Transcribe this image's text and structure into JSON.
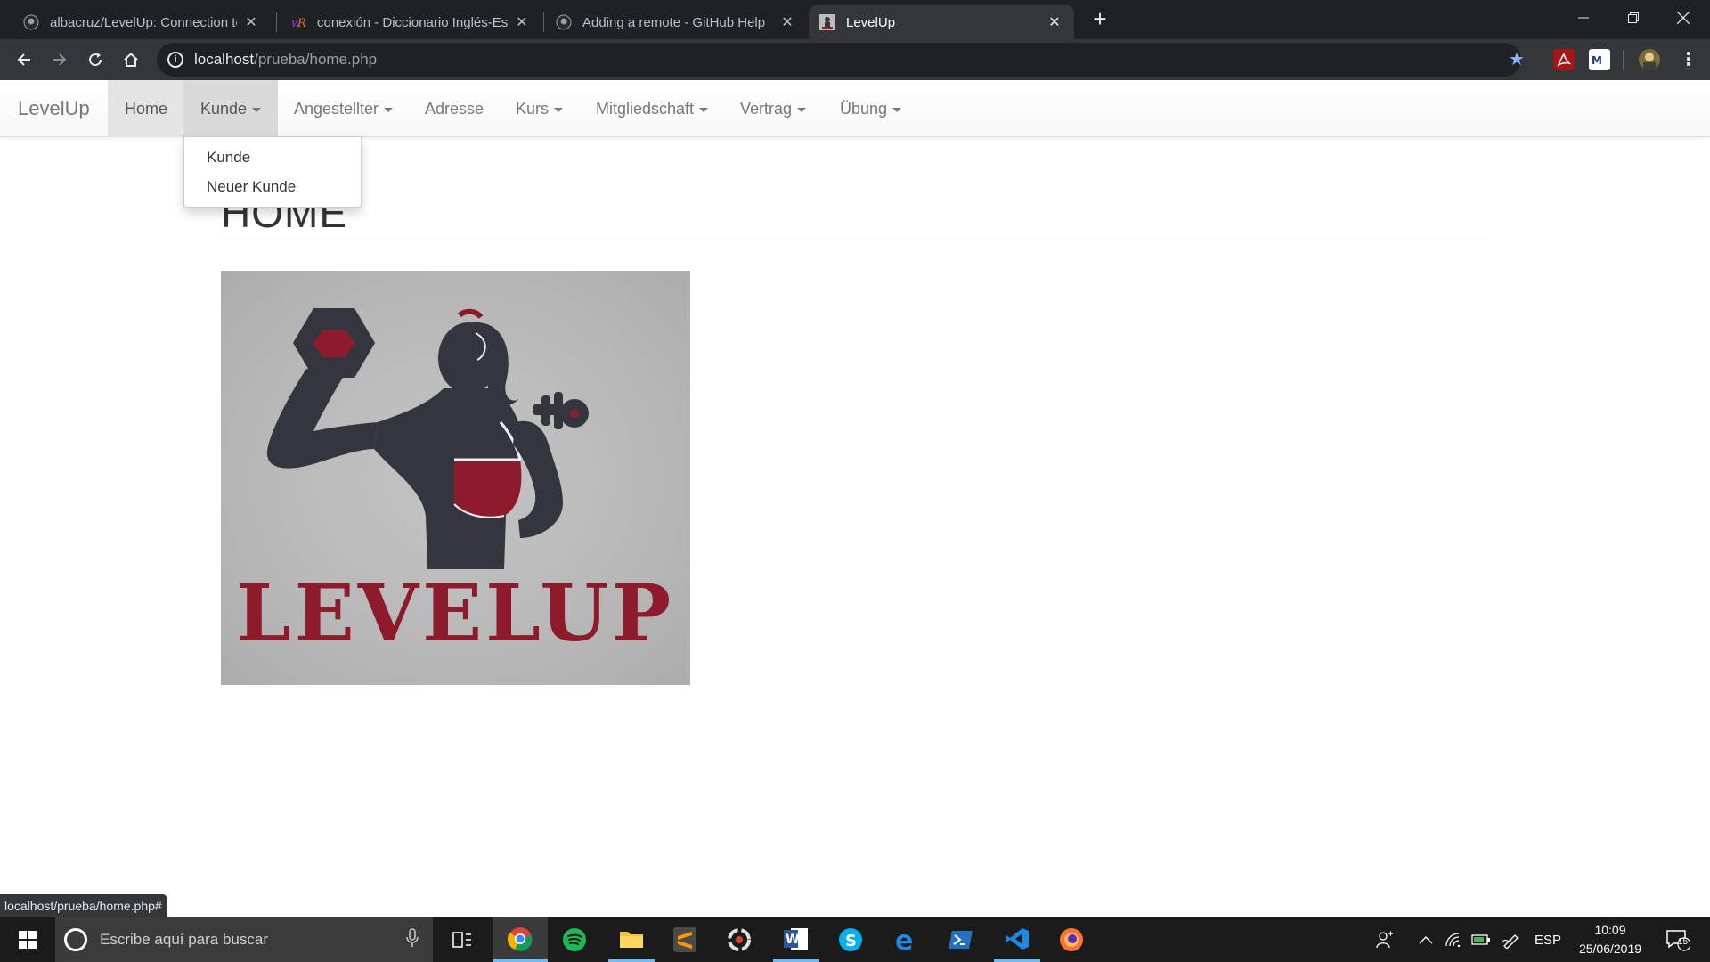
{
  "browser": {
    "tabs": [
      {
        "title": "albacruz/LevelUp: Connection to",
        "icon": "github-icon"
      },
      {
        "title": "conexión - Diccionario Inglés-Esp",
        "icon": "wordreference-icon"
      },
      {
        "title": "Adding a remote - GitHub Help",
        "icon": "github-icon"
      },
      {
        "title": "LevelUp",
        "icon": "levelup-favicon"
      }
    ],
    "new_tab": "+",
    "url_host": "localhost",
    "url_path": "/prueba/home.php",
    "status_url": "localhost/prueba/home.php#"
  },
  "navbar": {
    "brand": "LevelUp",
    "items": [
      {
        "label": "Home",
        "dropdown": false
      },
      {
        "label": "Kunde",
        "dropdown": true
      },
      {
        "label": "Angestellter",
        "dropdown": true
      },
      {
        "label": "Adresse",
        "dropdown": false
      },
      {
        "label": "Kurs",
        "dropdown": true
      },
      {
        "label": "Mitgliedschaft",
        "dropdown": true
      },
      {
        "label": "Vertrag",
        "dropdown": true
      },
      {
        "label": "Übung",
        "dropdown": true
      }
    ],
    "open_dropdown": {
      "menu": "Kunde",
      "items": [
        "Kunde",
        "Neuer Kunde"
      ]
    }
  },
  "page": {
    "heading": "HOME",
    "logo_text": "LEVELUP"
  },
  "taskbar": {
    "search_placeholder": "Escribe aquí para buscar",
    "language": "ESP",
    "time": "10:09",
    "date": "25/06/2019",
    "notification_count": "15"
  },
  "colors": {
    "brand_red": "#8e1b2b",
    "silhouette": "#33363f",
    "chrome_dark": "#202124",
    "chrome_toolbar": "#35363a"
  }
}
